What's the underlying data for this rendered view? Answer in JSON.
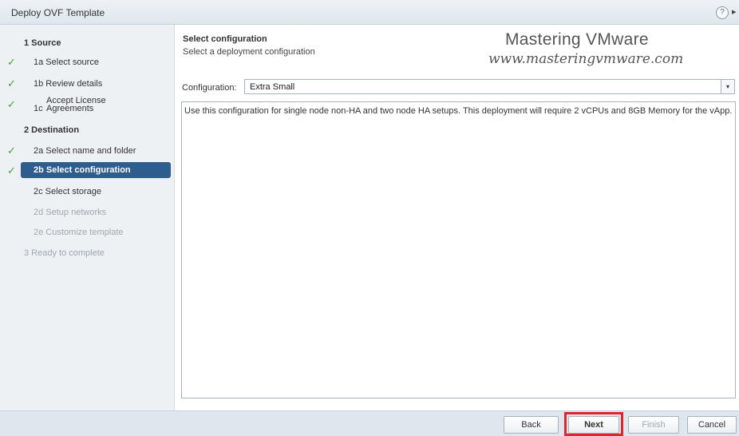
{
  "window": {
    "title": "Deploy OVF Template",
    "help_glyph": "?",
    "extra_glyph": "▸"
  },
  "sidebar": {
    "check_glyph": "✓",
    "items": [
      {
        "label": "1 Source",
        "type": "section",
        "checked": false
      },
      {
        "label": "1a Select source",
        "type": "sub",
        "checked": true
      },
      {
        "label": "1b Review details",
        "type": "sub",
        "checked": true
      },
      {
        "prefix": "1c",
        "line1": "Accept License",
        "line2": "Agreements",
        "type": "twoline",
        "checked": true
      },
      {
        "label": "2 Destination",
        "type": "section",
        "checked": false
      },
      {
        "label": "2a Select name and folder",
        "type": "sub",
        "checked": true
      },
      {
        "label": "2b Select configuration",
        "type": "active",
        "checked": true
      },
      {
        "label": "2c Select storage",
        "type": "sub",
        "checked": false
      },
      {
        "label": "2d Setup networks",
        "type": "disabled",
        "checked": false
      },
      {
        "label": "2e Customize template",
        "type": "disabled",
        "checked": false
      },
      {
        "label": "3 Ready to complete",
        "type": "plain",
        "checked": false
      }
    ]
  },
  "main": {
    "heading": "Select configuration",
    "subheading": "Select a deployment configuration",
    "config_label": "Configuration:",
    "config_value": "Extra Small",
    "config_arrow": "▾",
    "description": "Use this configuration for single node non-HA and two node HA setups.  This deployment will require 2 vCPUs and 8GB Memory for the vApp."
  },
  "watermark": {
    "title": "Mastering VMware",
    "url": "www.masteringvmware.com"
  },
  "footer": {
    "back": "Back",
    "next": "Next",
    "finish": "Finish",
    "cancel": "Cancel"
  },
  "colors": {
    "accent_active": "#2f5d8d",
    "check_green": "#3aa53a",
    "highlight_red": "#e0262a"
  }
}
